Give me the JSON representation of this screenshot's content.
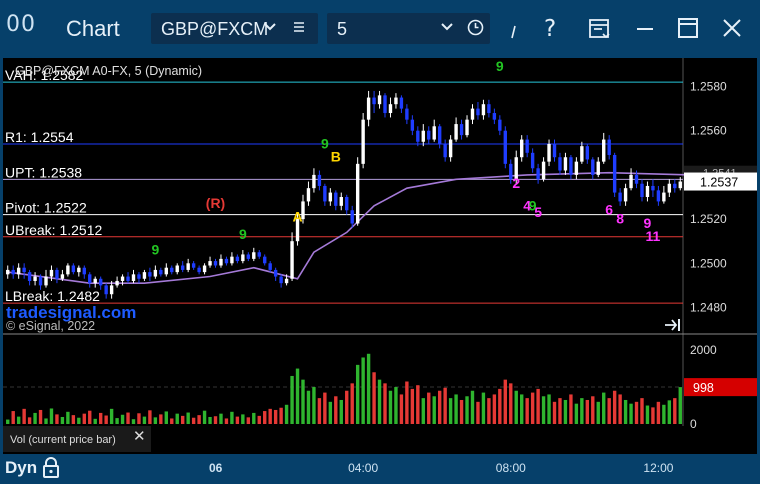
{
  "window": {
    "logo": "00",
    "title": "Chart",
    "symbol": "GBP@FXCM",
    "interval": "5"
  },
  "chart_data": {
    "type": "candlestick",
    "title": "GBP@FXCM A0-FX, 5 (Dynamic)",
    "watermark": "tradesignal.com",
    "copyright": "© eSignal, 2022",
    "price_axis": {
      "ylim": [
        1.2468,
        1.2592
      ],
      "ticks": [
        "1.2580",
        "1.2560",
        "1.2540",
        "1.2520",
        "1.2500",
        "1.2480"
      ]
    },
    "current_price": {
      "value": 1.2537,
      "label": "1.2537"
    },
    "overlap_price_label": "1.2541",
    "levels": [
      {
        "label": "VAH: 1.2582",
        "value": 1.2582,
        "color": "#26c6da"
      },
      {
        "label": "R1: 1.2554",
        "value": 1.2554,
        "color": "#1e3cff"
      },
      {
        "label": "UPT: 1.2538",
        "value": 1.2538,
        "color": "#b39ddb"
      },
      {
        "label": "Pivot: 1.2522",
        "value": 1.2522,
        "color": "#ffffff"
      },
      {
        "label": "UBreak: 1.2512",
        "value": 1.2512,
        "color": "#e53935"
      },
      {
        "label": "LBreak: 1.2482",
        "value": 1.2482,
        "color": "#e53935"
      }
    ],
    "annotations": [
      {
        "text": "(R)",
        "color": "#e53935",
        "time": 38,
        "price": 1.2525
      },
      {
        "text": "A",
        "color": "#ffd600",
        "time": 53,
        "price": 1.2519
      },
      {
        "text": "B",
        "color": "#ffd600",
        "time": 60,
        "price": 1.2546
      },
      {
        "text": "2",
        "color": "#ff33ff",
        "time": 93,
        "price": 1.2534
      },
      {
        "text": "4",
        "color": "#ff33ff",
        "time": 95,
        "price": 1.2524
      },
      {
        "text": "5",
        "color": "#ff33ff",
        "time": 97,
        "price": 1.2521
      },
      {
        "text": "6",
        "color": "#ff33ff",
        "time": 110,
        "price": 1.2522
      },
      {
        "text": "8",
        "color": "#ff33ff",
        "time": 112,
        "price": 1.2518
      },
      {
        "text": "9",
        "color": "#ff33ff",
        "time": 117,
        "price": 1.2516
      },
      {
        "text": "11",
        "color": "#ff33ff",
        "time": 118,
        "price": 1.251
      },
      {
        "text": "9",
        "color": "#22c522",
        "time": 43,
        "price": 1.2511
      },
      {
        "text": "9",
        "color": "#22c522",
        "time": 58,
        "price": 1.2552
      },
      {
        "text": "9",
        "color": "#22c522",
        "time": 90,
        "price": 1.2587
      },
      {
        "text": "9",
        "color": "#22c522",
        "time": 96,
        "price": 1.2524
      },
      {
        "text": "9",
        "color": "#22c522",
        "time": 27,
        "price": 1.2504
      }
    ],
    "volume_axis": {
      "ylim": [
        0,
        2300
      ],
      "ticks": [
        "2000",
        "1000",
        "0"
      ]
    },
    "current_volume": {
      "value": 998,
      "label": "998"
    },
    "indicator_label": "Vol (current price bar)",
    "time_axis": {
      "ticks": [
        {
          "label": "06",
          "bar": 38
        },
        {
          "label": "04:00",
          "bar": 65
        },
        {
          "label": "08:00",
          "bar": 92
        },
        {
          "label": "12:00",
          "bar": 119
        }
      ]
    },
    "pivot_trend": [
      [
        0,
        1.2496
      ],
      [
        15,
        1.2491
      ],
      [
        25,
        1.2491
      ],
      [
        37,
        1.2494
      ],
      [
        45,
        1.2498
      ],
      [
        53,
        1.2493
      ],
      [
        56,
        1.2505
      ],
      [
        62,
        1.2514
      ],
      [
        67,
        1.2526
      ],
      [
        73,
        1.2534
      ],
      [
        82,
        1.2538
      ],
      [
        95,
        1.254
      ],
      [
        110,
        1.2541
      ],
      [
        125,
        1.254
      ]
    ],
    "bars": [
      {
        "o": 1.2495,
        "c": 1.2497,
        "h": 1.2499,
        "l": 1.2493,
        "v": 120
      },
      {
        "o": 1.2497,
        "c": 1.2495,
        "h": 1.2499,
        "l": 1.2493,
        "v": 350
      },
      {
        "o": 1.2495,
        "c": 1.2498,
        "h": 1.25,
        "l": 1.2493,
        "v": 200
      },
      {
        "o": 1.2498,
        "c": 1.2496,
        "h": 1.25,
        "l": 1.2493,
        "v": 410
      },
      {
        "o": 1.2496,
        "c": 1.2492,
        "h": 1.2497,
        "l": 1.249,
        "v": 180
      },
      {
        "o": 1.2492,
        "c": 1.2494,
        "h": 1.2496,
        "l": 1.249,
        "v": 300
      },
      {
        "o": 1.2494,
        "c": 1.249,
        "h": 1.2495,
        "l": 1.2488,
        "v": 380
      },
      {
        "o": 1.249,
        "c": 1.2494,
        "h": 1.2497,
        "l": 1.2489,
        "v": 150
      },
      {
        "o": 1.2494,
        "c": 1.2497,
        "h": 1.2499,
        "l": 1.2492,
        "v": 420
      },
      {
        "o": 1.2497,
        "c": 1.2493,
        "h": 1.2498,
        "l": 1.2491,
        "v": 260
      },
      {
        "o": 1.2493,
        "c": 1.2495,
        "h": 1.2497,
        "l": 1.2492,
        "v": 190
      },
      {
        "o": 1.2495,
        "c": 1.2499,
        "h": 1.25,
        "l": 1.2494,
        "v": 330
      },
      {
        "o": 1.2499,
        "c": 1.2496,
        "h": 1.25,
        "l": 1.2495,
        "v": 240
      },
      {
        "o": 1.2496,
        "c": 1.2498,
        "h": 1.2499,
        "l": 1.2494,
        "v": 170
      },
      {
        "o": 1.2498,
        "c": 1.2495,
        "h": 1.2499,
        "l": 1.2493,
        "v": 280
      },
      {
        "o": 1.2495,
        "c": 1.2491,
        "h": 1.2496,
        "l": 1.2489,
        "v": 360
      },
      {
        "o": 1.2491,
        "c": 1.2493,
        "h": 1.2494,
        "l": 1.2489,
        "v": 140
      },
      {
        "o": 1.2493,
        "c": 1.249,
        "h": 1.2494,
        "l": 1.2488,
        "v": 300
      },
      {
        "o": 1.249,
        "c": 1.2486,
        "h": 1.2491,
        "l": 1.2484,
        "v": 230
      },
      {
        "o": 1.2486,
        "c": 1.249,
        "h": 1.2492,
        "l": 1.2484,
        "v": 410
      },
      {
        "o": 1.249,
        "c": 1.2492,
        "h": 1.2494,
        "l": 1.2489,
        "v": 160
      },
      {
        "o": 1.2492,
        "c": 1.2494,
        "h": 1.2495,
        "l": 1.249,
        "v": 250
      },
      {
        "o": 1.2494,
        "c": 1.2492,
        "h": 1.2496,
        "l": 1.2491,
        "v": 310
      },
      {
        "o": 1.2492,
        "c": 1.2495,
        "h": 1.2497,
        "l": 1.2491,
        "v": 130
      },
      {
        "o": 1.2495,
        "c": 1.2493,
        "h": 1.2496,
        "l": 1.2491,
        "v": 290
      },
      {
        "o": 1.2493,
        "c": 1.2496,
        "h": 1.2497,
        "l": 1.2492,
        "v": 200
      },
      {
        "o": 1.2496,
        "c": 1.2494,
        "h": 1.2498,
        "l": 1.2492,
        "v": 370
      },
      {
        "o": 1.2494,
        "c": 1.2497,
        "h": 1.2499,
        "l": 1.2493,
        "v": 180
      },
      {
        "o": 1.2497,
        "c": 1.2495,
        "h": 1.2498,
        "l": 1.2494,
        "v": 260
      },
      {
        "o": 1.2495,
        "c": 1.2498,
        "h": 1.25,
        "l": 1.2494,
        "v": 340
      },
      {
        "o": 1.2498,
        "c": 1.2496,
        "h": 1.2499,
        "l": 1.2495,
        "v": 150
      },
      {
        "o": 1.2496,
        "c": 1.2499,
        "h": 1.25,
        "l": 1.2495,
        "v": 280
      },
      {
        "o": 1.2499,
        "c": 1.2497,
        "h": 1.2501,
        "l": 1.2496,
        "v": 220
      },
      {
        "o": 1.2497,
        "c": 1.25,
        "h": 1.2502,
        "l": 1.2496,
        "v": 310
      },
      {
        "o": 1.25,
        "c": 1.2498,
        "h": 1.2501,
        "l": 1.2497,
        "v": 170
      },
      {
        "o": 1.2498,
        "c": 1.2496,
        "h": 1.2499,
        "l": 1.2495,
        "v": 240
      },
      {
        "o": 1.2496,
        "c": 1.2499,
        "h": 1.25,
        "l": 1.2495,
        "v": 360
      },
      {
        "o": 1.2499,
        "c": 1.2501,
        "h": 1.2503,
        "l": 1.2498,
        "v": 190
      },
      {
        "o": 1.2501,
        "c": 1.2499,
        "h": 1.2502,
        "l": 1.2498,
        "v": 210
      },
      {
        "o": 1.2499,
        "c": 1.2502,
        "h": 1.2504,
        "l": 1.2498,
        "v": 280
      },
      {
        "o": 1.2502,
        "c": 1.25,
        "h": 1.2503,
        "l": 1.2499,
        "v": 150
      },
      {
        "o": 1.25,
        "c": 1.2503,
        "h": 1.2505,
        "l": 1.2499,
        "v": 330
      },
      {
        "o": 1.2503,
        "c": 1.2501,
        "h": 1.2504,
        "l": 1.25,
        "v": 200
      },
      {
        "o": 1.2501,
        "c": 1.2504,
        "h": 1.2506,
        "l": 1.25,
        "v": 260
      },
      {
        "o": 1.2504,
        "c": 1.2502,
        "h": 1.2505,
        "l": 1.2501,
        "v": 180
      },
      {
        "o": 1.2502,
        "c": 1.2505,
        "h": 1.2507,
        "l": 1.2501,
        "v": 300
      },
      {
        "o": 1.2505,
        "c": 1.2503,
        "h": 1.2506,
        "l": 1.2502,
        "v": 220
      },
      {
        "o": 1.2503,
        "c": 1.25,
        "h": 1.2504,
        "l": 1.2499,
        "v": 350
      },
      {
        "o": 1.25,
        "c": 1.2497,
        "h": 1.2501,
        "l": 1.2496,
        "v": 410
      },
      {
        "o": 1.2497,
        "c": 1.2494,
        "h": 1.2498,
        "l": 1.2492,
        "v": 380
      },
      {
        "o": 1.2494,
        "c": 1.2491,
        "h": 1.2495,
        "l": 1.2489,
        "v": 440
      },
      {
        "o": 1.2491,
        "c": 1.2493,
        "h": 1.2495,
        "l": 1.249,
        "v": 520
      },
      {
        "o": 1.2493,
        "c": 1.251,
        "h": 1.2514,
        "l": 1.2492,
        "v": 1300
      },
      {
        "o": 1.251,
        "c": 1.252,
        "h": 1.2523,
        "l": 1.2508,
        "v": 1500
      },
      {
        "o": 1.252,
        "c": 1.2528,
        "h": 1.2531,
        "l": 1.2518,
        "v": 1200
      },
      {
        "o": 1.2528,
        "c": 1.2534,
        "h": 1.2537,
        "l": 1.2526,
        "v": 900
      },
      {
        "o": 1.2534,
        "c": 1.254,
        "h": 1.2543,
        "l": 1.2532,
        "v": 1000
      },
      {
        "o": 1.254,
        "c": 1.2535,
        "h": 1.2542,
        "l": 1.2533,
        "v": 700
      },
      {
        "o": 1.2535,
        "c": 1.2528,
        "h": 1.2536,
        "l": 1.2526,
        "v": 850
      },
      {
        "o": 1.2528,
        "c": 1.2532,
        "h": 1.2534,
        "l": 1.2526,
        "v": 600
      },
      {
        "o": 1.2532,
        "c": 1.2526,
        "h": 1.2533,
        "l": 1.2524,
        "v": 750
      },
      {
        "o": 1.2526,
        "c": 1.253,
        "h": 1.2532,
        "l": 1.2524,
        "v": 650
      },
      {
        "o": 1.253,
        "c": 1.2524,
        "h": 1.2531,
        "l": 1.2522,
        "v": 900
      },
      {
        "o": 1.2524,
        "c": 1.2518,
        "h": 1.2526,
        "l": 1.2516,
        "v": 1100
      },
      {
        "o": 1.2518,
        "c": 1.2545,
        "h": 1.2548,
        "l": 1.2517,
        "v": 1600
      },
      {
        "o": 1.2545,
        "c": 1.2565,
        "h": 1.2568,
        "l": 1.2543,
        "v": 1800
      },
      {
        "o": 1.2565,
        "c": 1.2575,
        "h": 1.2578,
        "l": 1.2562,
        "v": 1900
      },
      {
        "o": 1.2575,
        "c": 1.2572,
        "h": 1.2578,
        "l": 1.2568,
        "v": 1400
      },
      {
        "o": 1.2572,
        "c": 1.2576,
        "h": 1.2578,
        "l": 1.257,
        "v": 1200
      },
      {
        "o": 1.2576,
        "c": 1.2568,
        "h": 1.2577,
        "l": 1.2566,
        "v": 1100
      },
      {
        "o": 1.2568,
        "c": 1.2572,
        "h": 1.2575,
        "l": 1.2566,
        "v": 900
      },
      {
        "o": 1.2572,
        "c": 1.2575,
        "h": 1.2577,
        "l": 1.257,
        "v": 1000
      },
      {
        "o": 1.2575,
        "c": 1.257,
        "h": 1.2576,
        "l": 1.2568,
        "v": 800
      },
      {
        "o": 1.257,
        "c": 1.2565,
        "h": 1.2572,
        "l": 1.2563,
        "v": 1150
      },
      {
        "o": 1.2565,
        "c": 1.256,
        "h": 1.2567,
        "l": 1.2558,
        "v": 950
      },
      {
        "o": 1.256,
        "c": 1.2555,
        "h": 1.2562,
        "l": 1.2553,
        "v": 1050
      },
      {
        "o": 1.2555,
        "c": 1.256,
        "h": 1.2563,
        "l": 1.2553,
        "v": 700
      },
      {
        "o": 1.256,
        "c": 1.2556,
        "h": 1.2562,
        "l": 1.2554,
        "v": 850
      },
      {
        "o": 1.2556,
        "c": 1.2562,
        "h": 1.2565,
        "l": 1.2555,
        "v": 750
      },
      {
        "o": 1.2562,
        "c": 1.2554,
        "h": 1.2563,
        "l": 1.2552,
        "v": 900
      },
      {
        "o": 1.2554,
        "c": 1.2548,
        "h": 1.2556,
        "l": 1.2546,
        "v": 980
      },
      {
        "o": 1.2548,
        "c": 1.2556,
        "h": 1.2558,
        "l": 1.2546,
        "v": 700
      },
      {
        "o": 1.2556,
        "c": 1.2563,
        "h": 1.2566,
        "l": 1.2555,
        "v": 800
      },
      {
        "o": 1.2563,
        "c": 1.2558,
        "h": 1.2565,
        "l": 1.2556,
        "v": 650
      },
      {
        "o": 1.2558,
        "c": 1.2565,
        "h": 1.2567,
        "l": 1.2557,
        "v": 750
      },
      {
        "o": 1.2565,
        "c": 1.257,
        "h": 1.2572,
        "l": 1.2563,
        "v": 900
      },
      {
        "o": 1.257,
        "c": 1.2567,
        "h": 1.2573,
        "l": 1.2565,
        "v": 600
      },
      {
        "o": 1.2567,
        "c": 1.2572,
        "h": 1.2574,
        "l": 1.2565,
        "v": 850
      },
      {
        "o": 1.2572,
        "c": 1.2568,
        "h": 1.2574,
        "l": 1.2566,
        "v": 700
      },
      {
        "o": 1.2568,
        "c": 1.2565,
        "h": 1.257,
        "l": 1.2563,
        "v": 800
      },
      {
        "o": 1.2565,
        "c": 1.256,
        "h": 1.2567,
        "l": 1.2558,
        "v": 950
      },
      {
        "o": 1.256,
        "c": 1.2545,
        "h": 1.2562,
        "l": 1.2543,
        "v": 1200
      },
      {
        "o": 1.2545,
        "c": 1.2538,
        "h": 1.2547,
        "l": 1.2536,
        "v": 1100
      },
      {
        "o": 1.2538,
        "c": 1.2548,
        "h": 1.2551,
        "l": 1.2536,
        "v": 900
      },
      {
        "o": 1.2548,
        "c": 1.2556,
        "h": 1.2558,
        "l": 1.2546,
        "v": 800
      },
      {
        "o": 1.2556,
        "c": 1.255,
        "h": 1.2558,
        "l": 1.2548,
        "v": 700
      },
      {
        "o": 1.255,
        "c": 1.2543,
        "h": 1.2552,
        "l": 1.2541,
        "v": 850
      },
      {
        "o": 1.2543,
        "c": 1.2538,
        "h": 1.2545,
        "l": 1.2536,
        "v": 950
      },
      {
        "o": 1.2538,
        "c": 1.2546,
        "h": 1.2548,
        "l": 1.2537,
        "v": 750
      },
      {
        "o": 1.2546,
        "c": 1.2554,
        "h": 1.2556,
        "l": 1.2544,
        "v": 800
      },
      {
        "o": 1.2554,
        "c": 1.2548,
        "h": 1.2556,
        "l": 1.2546,
        "v": 600
      },
      {
        "o": 1.2548,
        "c": 1.2542,
        "h": 1.255,
        "l": 1.254,
        "v": 700
      },
      {
        "o": 1.2542,
        "c": 1.2548,
        "h": 1.255,
        "l": 1.254,
        "v": 650
      },
      {
        "o": 1.2548,
        "c": 1.254,
        "h": 1.2549,
        "l": 1.2538,
        "v": 800
      },
      {
        "o": 1.254,
        "c": 1.2546,
        "h": 1.2548,
        "l": 1.2538,
        "v": 550
      },
      {
        "o": 1.2546,
        "c": 1.2553,
        "h": 1.2555,
        "l": 1.2545,
        "v": 700
      },
      {
        "o": 1.2553,
        "c": 1.2547,
        "h": 1.2554,
        "l": 1.2545,
        "v": 650
      },
      {
        "o": 1.2547,
        "c": 1.254,
        "h": 1.2548,
        "l": 1.2538,
        "v": 750
      },
      {
        "o": 1.254,
        "c": 1.2546,
        "h": 1.2548,
        "l": 1.2539,
        "v": 600
      },
      {
        "o": 1.2546,
        "c": 1.2556,
        "h": 1.2559,
        "l": 1.2545,
        "v": 850
      },
      {
        "o": 1.2556,
        "c": 1.2549,
        "h": 1.2558,
        "l": 1.2547,
        "v": 700
      },
      {
        "o": 1.2549,
        "c": 1.2532,
        "h": 1.255,
        "l": 1.253,
        "v": 900
      },
      {
        "o": 1.2532,
        "c": 1.2528,
        "h": 1.2534,
        "l": 1.2526,
        "v": 800
      },
      {
        "o": 1.2528,
        "c": 1.2534,
        "h": 1.2536,
        "l": 1.2526,
        "v": 650
      },
      {
        "o": 1.2534,
        "c": 1.254,
        "h": 1.2543,
        "l": 1.2533,
        "v": 550
      },
      {
        "o": 1.254,
        "c": 1.2536,
        "h": 1.2542,
        "l": 1.2534,
        "v": 600
      },
      {
        "o": 1.2536,
        "c": 1.253,
        "h": 1.2538,
        "l": 1.2528,
        "v": 700
      },
      {
        "o": 1.253,
        "c": 1.2535,
        "h": 1.2537,
        "l": 1.2528,
        "v": 500
      },
      {
        "o": 1.2535,
        "c": 1.2533,
        "h": 1.2538,
        "l": 1.253,
        "v": 450
      },
      {
        "o": 1.2533,
        "c": 1.2528,
        "h": 1.2535,
        "l": 1.2526,
        "v": 600
      },
      {
        "o": 1.2528,
        "c": 1.2532,
        "h": 1.2535,
        "l": 1.2527,
        "v": 520
      },
      {
        "o": 1.2532,
        "c": 1.2536,
        "h": 1.2538,
        "l": 1.253,
        "v": 640
      },
      {
        "o": 1.2536,
        "c": 1.2534,
        "h": 1.2538,
        "l": 1.2532,
        "v": 700
      },
      {
        "o": 1.2534,
        "c": 1.2537,
        "h": 1.2539,
        "l": 1.2533,
        "v": 998
      }
    ]
  }
}
